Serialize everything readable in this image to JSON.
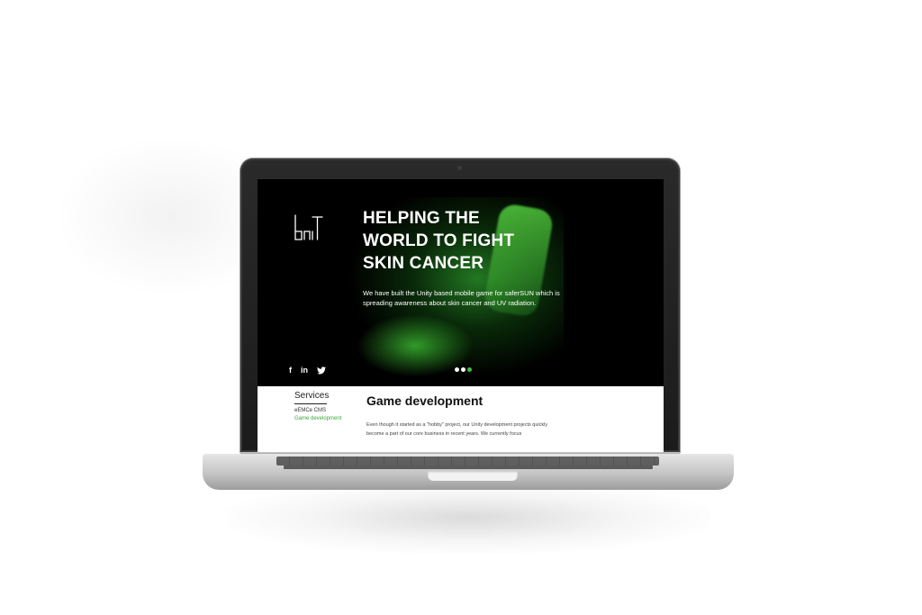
{
  "hero": {
    "headline_lines": [
      "HELPING THE",
      "WORLD TO FIGHT",
      "SKIN CANCER"
    ],
    "description": "We have built the Unity based mobile game for saferSUN which is spreading awareness about skin cancer and UV radiation.",
    "logo": "bɑT",
    "social": [
      {
        "icon": "facebook-icon",
        "glyph": "f"
      },
      {
        "icon": "linkedin-icon",
        "glyph": "in"
      },
      {
        "icon": "twitter-icon",
        "glyph": "ὂ6"
      }
    ],
    "slider": {
      "count": 3,
      "active_index": 2
    }
  },
  "services": {
    "title": "Services",
    "items": [
      {
        "label": "eEMCe CMS",
        "active": false
      },
      {
        "label": "Game development",
        "active": true
      }
    ]
  },
  "main": {
    "section_title": "Game development",
    "body": "Even though it started as a \"hobby\" project, our Unity development projects quickly become a part of our core business in recent years. We currently focus"
  },
  "colors": {
    "accent_green": "#3fbf3f",
    "hero_bg": "#000000",
    "content_bg": "#ffffff"
  }
}
